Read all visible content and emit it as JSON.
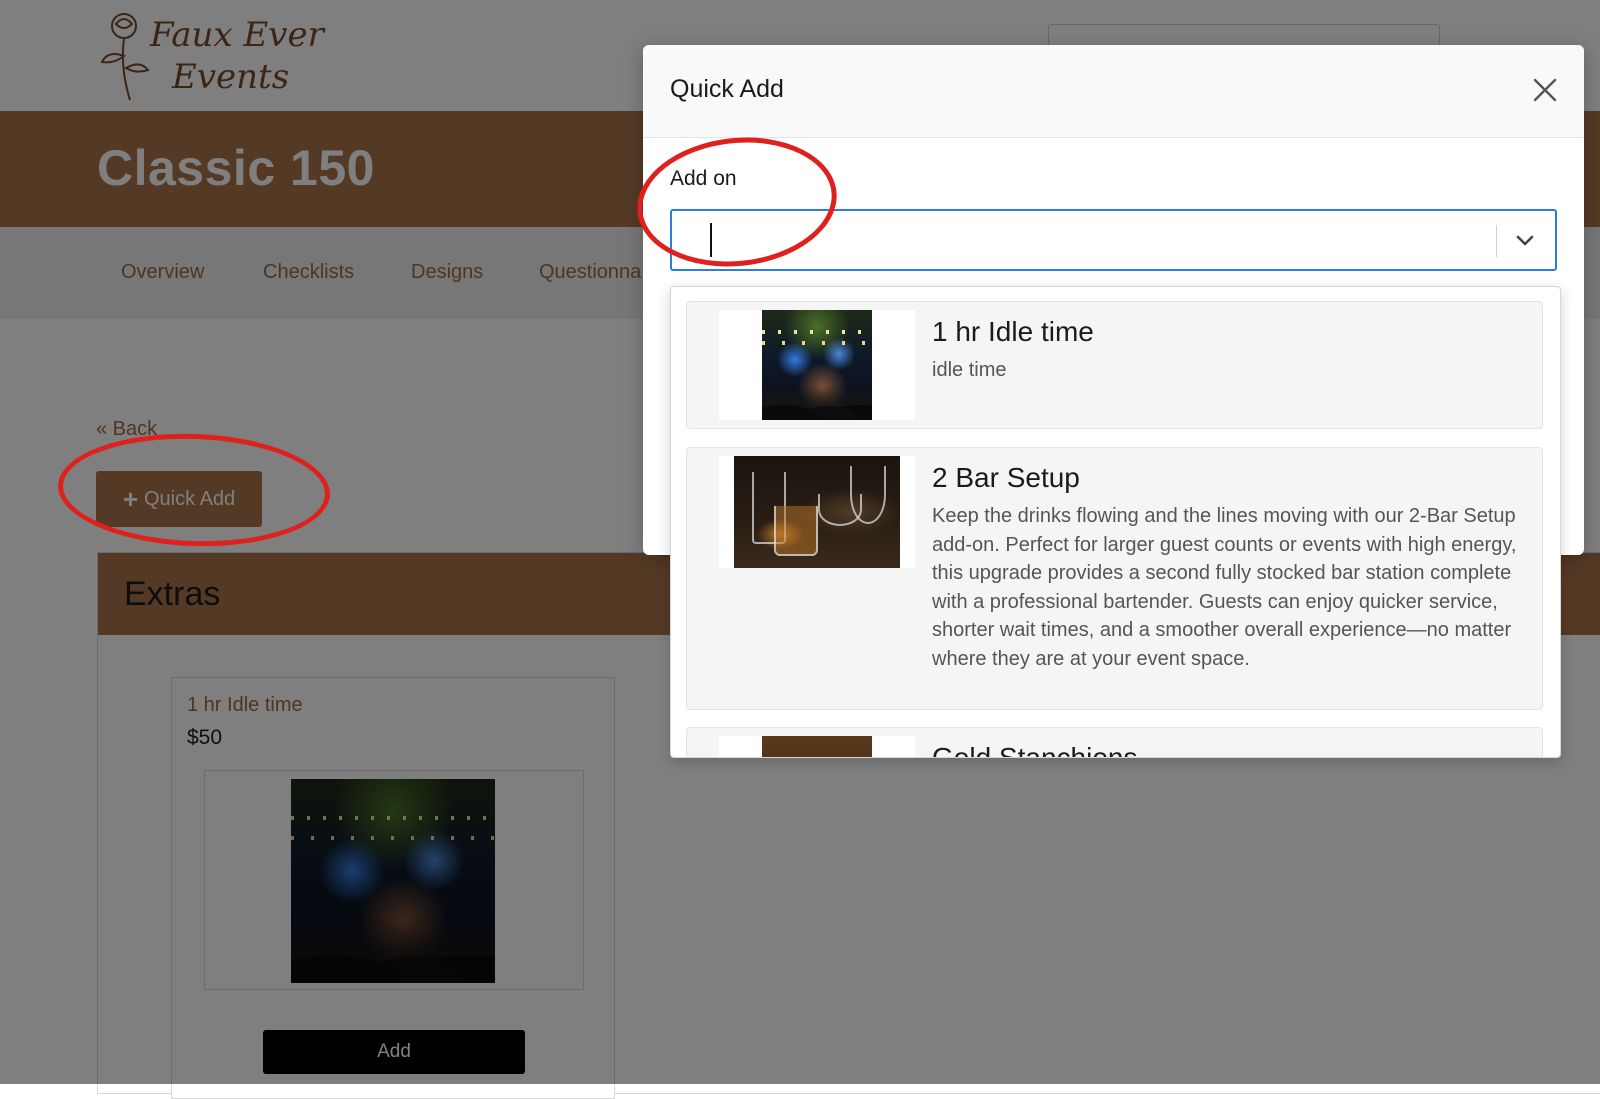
{
  "brand": {
    "logo_line1": "Faux Ever",
    "logo_line2": "Events"
  },
  "banner": {
    "title": "Classic 150"
  },
  "nav": {
    "items": [
      "Overview",
      "Checklists",
      "Designs",
      "Questionna"
    ]
  },
  "back_link": "« Back",
  "quick_add_button": {
    "icon": "plus-icon",
    "label": "Quick Add"
  },
  "extras": {
    "title": "Extras",
    "products": [
      {
        "name": "1 hr Idle time",
        "price": "$50",
        "add_label": "Add",
        "image": "band-performance-image"
      }
    ]
  },
  "modal": {
    "title": "Quick Add",
    "close_icon": "close-icon",
    "field_label": "Add on",
    "input_value": "",
    "chevron_icon": "chevron-down-icon",
    "options": [
      {
        "title": "1 hr Idle time",
        "description": "idle time",
        "image": "band-performance-image"
      },
      {
        "title": "2 Bar Setup",
        "description": "Keep the drinks flowing and the lines moving with our 2-Bar Setup add-on. Perfect for larger guest counts or events with high energy, this upgrade provides a second fully stocked bar station complete with a professional bartender. Guests can enjoy quicker service, shorter wait times, and a smoother overall experience—no matter where they are at your event space.",
        "image": "glassware-image"
      },
      {
        "title": "Gold Stanchions",
        "description": "",
        "image": "stanchions-image"
      }
    ]
  },
  "colors": {
    "brand_brown": "#a9744b",
    "link_brown": "#9c6a43",
    "focus_blue": "#2a7de1",
    "annotation_red": "#e0201c"
  }
}
